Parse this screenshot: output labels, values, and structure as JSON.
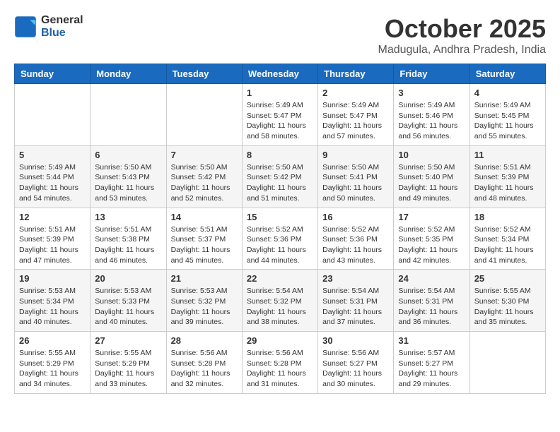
{
  "header": {
    "logo_general": "General",
    "logo_blue": "Blue",
    "month_title": "October 2025",
    "subtitle": "Madugula, Andhra Pradesh, India"
  },
  "days_of_week": [
    "Sunday",
    "Monday",
    "Tuesday",
    "Wednesday",
    "Thursday",
    "Friday",
    "Saturday"
  ],
  "weeks": [
    [
      {
        "day": "",
        "info": ""
      },
      {
        "day": "",
        "info": ""
      },
      {
        "day": "",
        "info": ""
      },
      {
        "day": "1",
        "info": "Sunrise: 5:49 AM\nSunset: 5:47 PM\nDaylight: 11 hours and 58 minutes."
      },
      {
        "day": "2",
        "info": "Sunrise: 5:49 AM\nSunset: 5:47 PM\nDaylight: 11 hours and 57 minutes."
      },
      {
        "day": "3",
        "info": "Sunrise: 5:49 AM\nSunset: 5:46 PM\nDaylight: 11 hours and 56 minutes."
      },
      {
        "day": "4",
        "info": "Sunrise: 5:49 AM\nSunset: 5:45 PM\nDaylight: 11 hours and 55 minutes."
      }
    ],
    [
      {
        "day": "5",
        "info": "Sunrise: 5:49 AM\nSunset: 5:44 PM\nDaylight: 11 hours and 54 minutes."
      },
      {
        "day": "6",
        "info": "Sunrise: 5:50 AM\nSunset: 5:43 PM\nDaylight: 11 hours and 53 minutes."
      },
      {
        "day": "7",
        "info": "Sunrise: 5:50 AM\nSunset: 5:42 PM\nDaylight: 11 hours and 52 minutes."
      },
      {
        "day": "8",
        "info": "Sunrise: 5:50 AM\nSunset: 5:42 PM\nDaylight: 11 hours and 51 minutes."
      },
      {
        "day": "9",
        "info": "Sunrise: 5:50 AM\nSunset: 5:41 PM\nDaylight: 11 hours and 50 minutes."
      },
      {
        "day": "10",
        "info": "Sunrise: 5:50 AM\nSunset: 5:40 PM\nDaylight: 11 hours and 49 minutes."
      },
      {
        "day": "11",
        "info": "Sunrise: 5:51 AM\nSunset: 5:39 PM\nDaylight: 11 hours and 48 minutes."
      }
    ],
    [
      {
        "day": "12",
        "info": "Sunrise: 5:51 AM\nSunset: 5:39 PM\nDaylight: 11 hours and 47 minutes."
      },
      {
        "day": "13",
        "info": "Sunrise: 5:51 AM\nSunset: 5:38 PM\nDaylight: 11 hours and 46 minutes."
      },
      {
        "day": "14",
        "info": "Sunrise: 5:51 AM\nSunset: 5:37 PM\nDaylight: 11 hours and 45 minutes."
      },
      {
        "day": "15",
        "info": "Sunrise: 5:52 AM\nSunset: 5:36 PM\nDaylight: 11 hours and 44 minutes."
      },
      {
        "day": "16",
        "info": "Sunrise: 5:52 AM\nSunset: 5:36 PM\nDaylight: 11 hours and 43 minutes."
      },
      {
        "day": "17",
        "info": "Sunrise: 5:52 AM\nSunset: 5:35 PM\nDaylight: 11 hours and 42 minutes."
      },
      {
        "day": "18",
        "info": "Sunrise: 5:52 AM\nSunset: 5:34 PM\nDaylight: 11 hours and 41 minutes."
      }
    ],
    [
      {
        "day": "19",
        "info": "Sunrise: 5:53 AM\nSunset: 5:34 PM\nDaylight: 11 hours and 40 minutes."
      },
      {
        "day": "20",
        "info": "Sunrise: 5:53 AM\nSunset: 5:33 PM\nDaylight: 11 hours and 40 minutes."
      },
      {
        "day": "21",
        "info": "Sunrise: 5:53 AM\nSunset: 5:32 PM\nDaylight: 11 hours and 39 minutes."
      },
      {
        "day": "22",
        "info": "Sunrise: 5:54 AM\nSunset: 5:32 PM\nDaylight: 11 hours and 38 minutes."
      },
      {
        "day": "23",
        "info": "Sunrise: 5:54 AM\nSunset: 5:31 PM\nDaylight: 11 hours and 37 minutes."
      },
      {
        "day": "24",
        "info": "Sunrise: 5:54 AM\nSunset: 5:31 PM\nDaylight: 11 hours and 36 minutes."
      },
      {
        "day": "25",
        "info": "Sunrise: 5:55 AM\nSunset: 5:30 PM\nDaylight: 11 hours and 35 minutes."
      }
    ],
    [
      {
        "day": "26",
        "info": "Sunrise: 5:55 AM\nSunset: 5:29 PM\nDaylight: 11 hours and 34 minutes."
      },
      {
        "day": "27",
        "info": "Sunrise: 5:55 AM\nSunset: 5:29 PM\nDaylight: 11 hours and 33 minutes."
      },
      {
        "day": "28",
        "info": "Sunrise: 5:56 AM\nSunset: 5:28 PM\nDaylight: 11 hours and 32 minutes."
      },
      {
        "day": "29",
        "info": "Sunrise: 5:56 AM\nSunset: 5:28 PM\nDaylight: 11 hours and 31 minutes."
      },
      {
        "day": "30",
        "info": "Sunrise: 5:56 AM\nSunset: 5:27 PM\nDaylight: 11 hours and 30 minutes."
      },
      {
        "day": "31",
        "info": "Sunrise: 5:57 AM\nSunset: 5:27 PM\nDaylight: 11 hours and 29 minutes."
      },
      {
        "day": "",
        "info": ""
      }
    ]
  ]
}
